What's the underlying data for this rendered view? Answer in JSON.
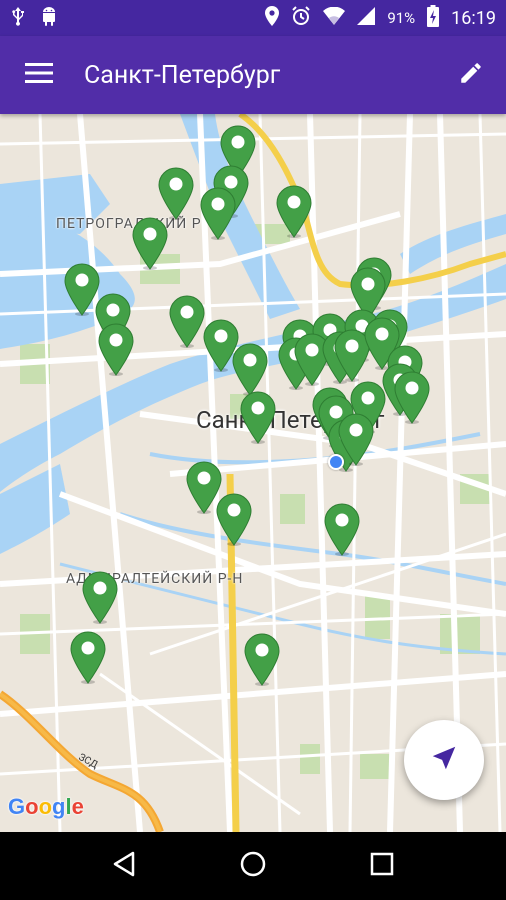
{
  "status": {
    "battery_percent": "91%",
    "time": "16:19"
  },
  "app_bar": {
    "title": "Санкт-Петербург"
  },
  "map": {
    "district_labels": [
      "ПЕТРОГРАДСКИЙ Р",
      "АДМИРАЛТЕЙСКИЙ Р-Н"
    ],
    "city_label": "Санкт-Петербург",
    "road_label": "ЗСД",
    "attribution": "Google",
    "marker_color": "#43a047",
    "marker_count": 40
  },
  "colors": {
    "primary": "#512da8",
    "primary_dark": "#4527a0",
    "accent": "#4527a0",
    "water": "#a9d3f5",
    "park": "#c8dfb0",
    "highway": "#f4cf4a"
  }
}
